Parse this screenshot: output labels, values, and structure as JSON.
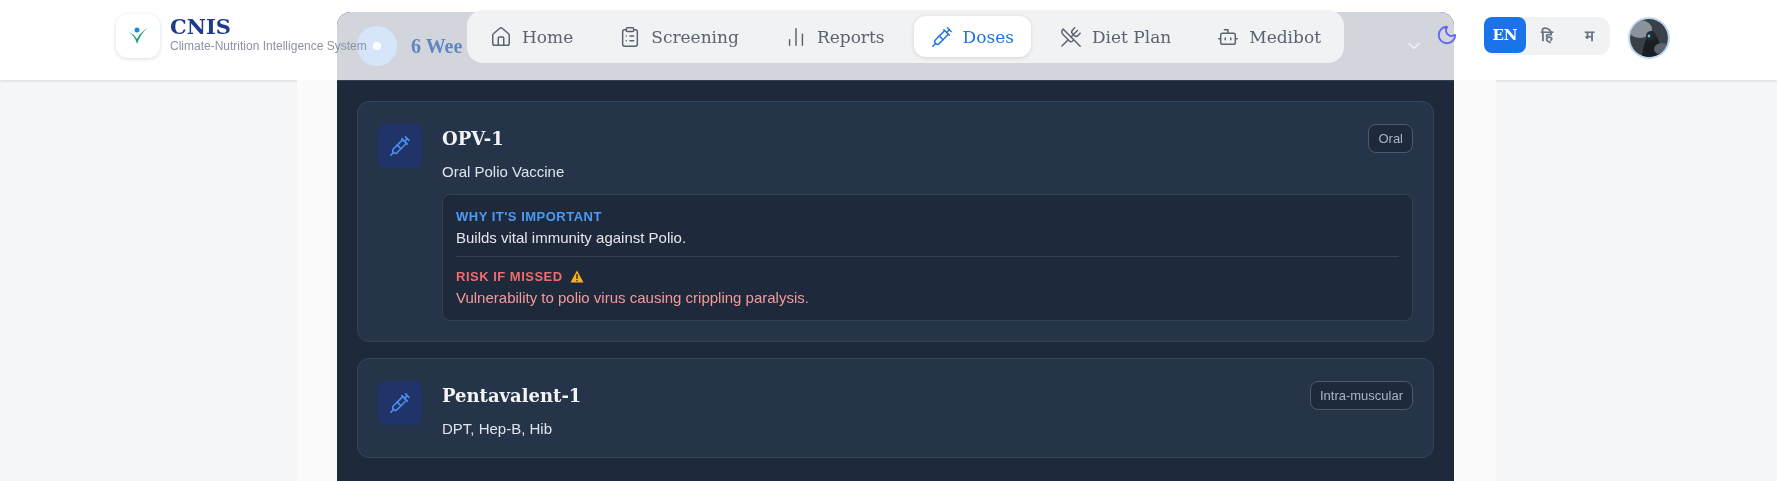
{
  "header": {
    "logo_title": "CNIS",
    "logo_subtitle": "Climate-Nutrition Intelligence System"
  },
  "nav": [
    {
      "label": "Home",
      "kind": "home",
      "selected": false
    },
    {
      "label": "Screening",
      "kind": "screening",
      "selected": false
    },
    {
      "label": "Reports",
      "kind": "reports",
      "selected": false
    },
    {
      "label": "Doses",
      "kind": "doses",
      "selected": true
    },
    {
      "label": "Diet Plan",
      "kind": "diet",
      "selected": false
    },
    {
      "label": "Medibot",
      "kind": "bot",
      "selected": false
    }
  ],
  "languages": [
    {
      "label": "EN",
      "selected": true
    },
    {
      "label": "हि",
      "selected": false
    },
    {
      "label": "म",
      "selected": false
    }
  ],
  "schedule": {
    "title": "6 Wee",
    "expanded": true,
    "vaccines": [
      {
        "name": "OPV-1",
        "full_name": "Oral Polio Vaccine",
        "route": "Oral",
        "why_label": "WHY IT'S IMPORTANT",
        "why": "Builds vital immunity against Polio.",
        "risk_label": "RISK IF MISSED",
        "risk": "Vulnerability to polio virus causing crippling paralysis."
      },
      {
        "name": "Pentavalent-1",
        "full_name": "DPT, Hep-B, Hib",
        "route": "Intra-muscular"
      }
    ]
  }
}
